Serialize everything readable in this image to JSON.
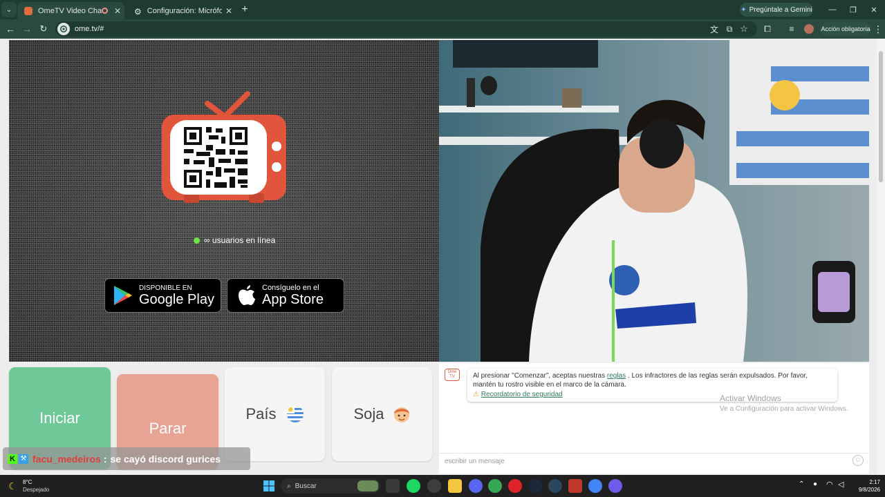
{
  "browser": {
    "tabs": [
      {
        "title": "OmeTV Video Chat — Alte",
        "favicon_color": "#e06d3c",
        "active": true
      },
      {
        "title": "Configuración: Micrófono",
        "active": false
      }
    ],
    "new_tab_glyph": "+",
    "url": "ome.tv/#",
    "gemini_label": "Pregúntale a Gemini",
    "account_label": "Acción obligatoria",
    "window_controls": [
      "—",
      "❐",
      "✕"
    ]
  },
  "stage": {
    "online_text": "∞ usuarios en línea",
    "google_play": {
      "small": "DISPONIBLE EN",
      "big": "Google Play"
    },
    "app_store": {
      "small": "Consíguelo en el",
      "big": "App Store"
    }
  },
  "controls": {
    "start_label": "Iniciar",
    "stop_label": "Parar",
    "country_label": "País",
    "gender_label": "Soja",
    "start_color": "#6ec897",
    "stop_color": "#e8a393"
  },
  "chat": {
    "rules_prefix": "Al presionar \"Comenzar\", aceptas nuestras",
    "rules_link": "reglas",
    "rules_suffix": ". Los infractores de las reglas serán expulsados. Por favor, mantén tu rostro visible en el marco de la cámara.",
    "safety_link": "Recordatorio de seguridad",
    "input_placeholder": "escribir un mensaje",
    "logo_text": "Ome TV"
  },
  "windows_watermark": {
    "line1": "Activar Windows",
    "line2": "Ve a Configuración para activar Windows."
  },
  "overlay": {
    "username": "facu_medeiros",
    "separator": ":",
    "message": "se cayó discord gurices"
  },
  "taskbar": {
    "weather_temp": "8°C",
    "weather_desc": "Despejado",
    "search_placeholder": "Buscar",
    "time": "2:17",
    "date": "9/8/2026"
  }
}
